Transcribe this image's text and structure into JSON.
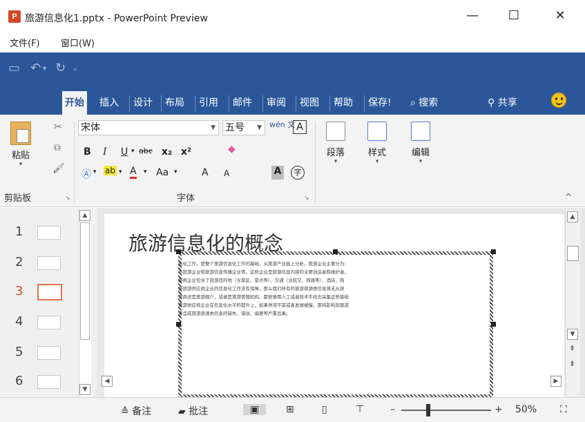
{
  "window": {
    "title": "旅游信息化1.pptx - PowerPoint Preview",
    "app_icon": "P",
    "minimize": "—",
    "maximize": "☐",
    "close": "✕"
  },
  "menu": [
    "文件(F)",
    "窗口(W)"
  ],
  "quick_access": [
    "save-icon",
    "undo-icon",
    "redo-icon",
    "customize-icon"
  ],
  "tabs": [
    {
      "label": "开始",
      "selected": true
    },
    {
      "label": "插入"
    },
    {
      "label": "设计"
    },
    {
      "label": "布局"
    },
    {
      "label": "引用"
    },
    {
      "label": "邮件"
    },
    {
      "label": "审阅"
    },
    {
      "label": "视图"
    },
    {
      "label": "帮助"
    },
    {
      "label": "保存!"
    }
  ],
  "search_label": "搜索",
  "share_label": "共享",
  "ribbon": {
    "clipboard": {
      "paste": "粘贴",
      "group": "剪贴板"
    },
    "font": {
      "name": "宋体",
      "size": "五号",
      "bold": "B",
      "italic": "I",
      "underline": "U",
      "strike": "abc",
      "subscript": "x₂",
      "superscript": "x²",
      "case": "Aa",
      "grow": "A",
      "shrink": "A",
      "char_shading": "A",
      "enclose": "字",
      "group": "字体"
    },
    "paragraph": "段落",
    "styles": "样式",
    "editing": "编辑"
  },
  "thumbnails": [
    {
      "num": "1"
    },
    {
      "num": "2"
    },
    {
      "num": "3",
      "selected": true
    },
    {
      "num": "4"
    },
    {
      "num": "5"
    },
    {
      "num": "6"
    }
  ],
  "slide": {
    "title": "旅游信息化的概念",
    "lines": [
      "息化工作，是整个旅游信息化工作的基础，从旅游产业链上分析，旅游企业主要分为：",
      "与旅游企业和旅游信息传播企业等。这些企业是旅游信息内容的主要创造者和维护者，",
      "游商企业包含了旅游目的地（含景区、景点等）、交通（含航空、铁路等）、酒店、购",
      "些旅游供应商企业的信息化工作没有保障，那么我们所有的旅游资源类信息将无从获",
      "旅商还是旅游媒介，或者是旅游管理机构，都很难用人工或者技术手段去采集这些基础",
      "旅游供应商企业在信息化水平的提升上，如果停滞不前或者发展缓慢，那将影响到旅游",
      "至造成旅游资源类信息的缺失、错误、偏差等严重后果。"
    ]
  },
  "status": {
    "notes": "备注",
    "comments": "批注",
    "zoom": "50%"
  }
}
